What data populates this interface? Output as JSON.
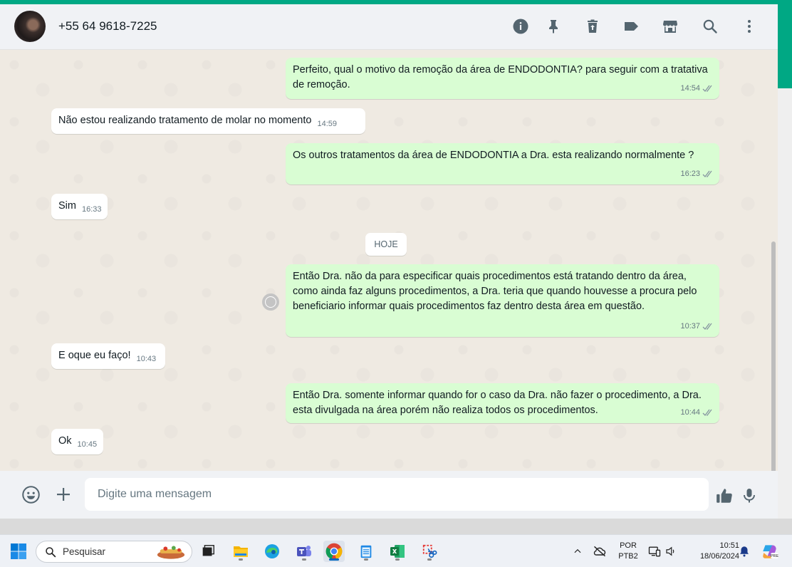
{
  "header": {
    "contact_name": "+55 64 9618-7225",
    "icons": [
      "info-icon",
      "pin-icon",
      "delete-icon",
      "label-icon",
      "catalog-icon",
      "search-icon",
      "menu-icon"
    ]
  },
  "messages": [
    {
      "direction": "out",
      "text": "Perfeito, qual o motivo da remoção da área de ENDODONTIA? para seguir com a tratativa de remoção.",
      "time": "14:54"
    },
    {
      "direction": "in",
      "text": "Não estou realizando tratamento de molar no momento",
      "time": "14:59"
    },
    {
      "direction": "out",
      "text": "Os outros tratamentos da área de ENDODONTIA a Dra. esta realizando normalmente ?",
      "time": "16:23"
    },
    {
      "direction": "in",
      "text": "Sim",
      "time": "16:33"
    },
    {
      "direction": "out",
      "text": "Então Dra. não da para especificar quais procedimentos está tratando dentro da área, como ainda faz alguns procedimentos, a Dra. teria que quando houvesse a procura pelo beneficiario informar quais procedimentos faz dentro desta área em questão.",
      "time": "10:37"
    },
    {
      "direction": "in",
      "text": "E oque eu faço!",
      "time": "10:43"
    },
    {
      "direction": "out",
      "text": "Então Dra. somente informar quando for o caso da Dra. não fazer o procedimento, a Dra. esta divulgada na área porém não realiza todos os procedimentos.",
      "time": "10:44"
    },
    {
      "direction": "in",
      "text": "Ok",
      "time": "10:45"
    }
  ],
  "date_divider": "HOJE",
  "composer": {
    "placeholder": "Digite uma mensagem"
  },
  "taskbar": {
    "search_label": "Pesquisar",
    "language_line1": "POR",
    "language_line2": "PTB2",
    "time": "10:51",
    "date": "18/06/2024"
  },
  "colors": {
    "accent": "#00a884",
    "outgoing_bubble": "#d9fdd3",
    "incoming_bubble": "#ffffff",
    "chat_background": "#efeae2"
  }
}
